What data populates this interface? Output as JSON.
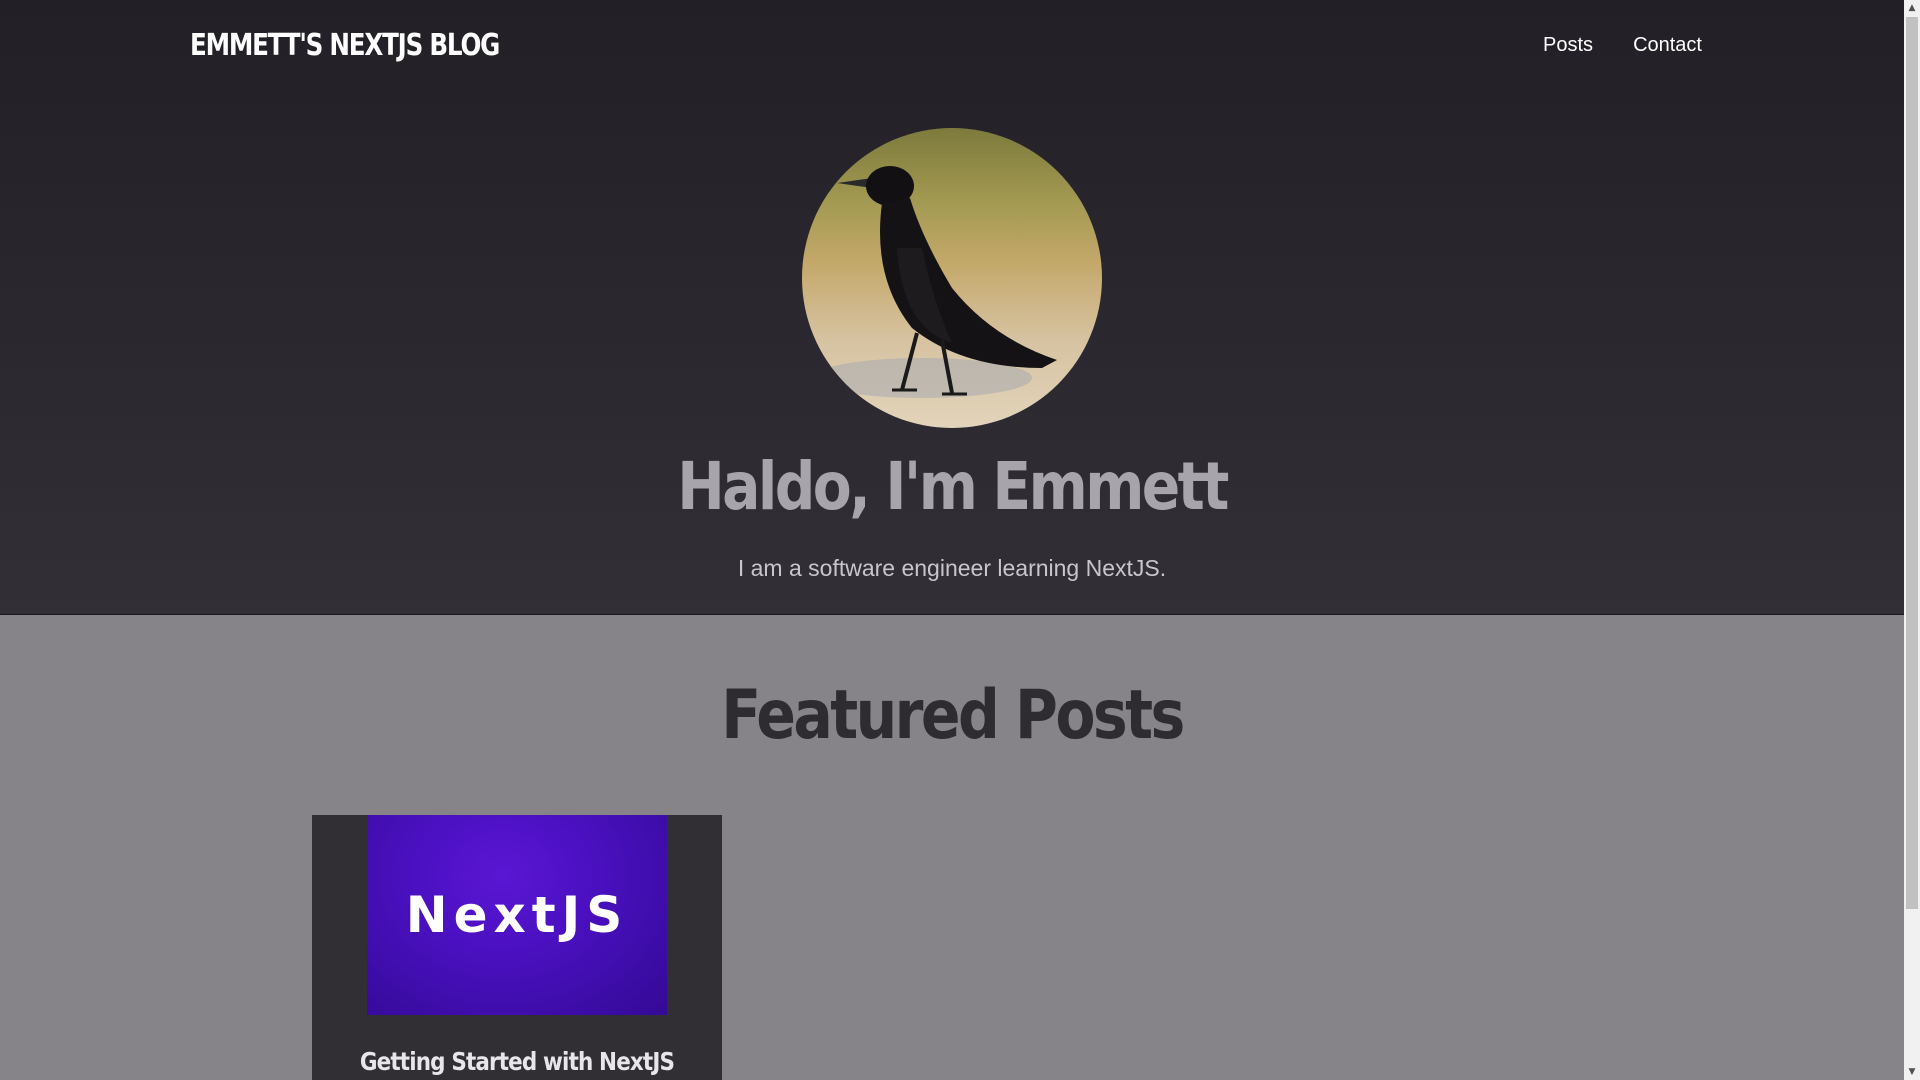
{
  "header": {
    "brand": "EMMETT'S NEXTJS BLOG",
    "nav": {
      "posts": "Posts",
      "contact": "Contact"
    }
  },
  "hero": {
    "title": "Haldo, I'm Emmett",
    "subtitle": "I am a software engineer learning NextJS."
  },
  "featured": {
    "heading": "Featured Posts",
    "posts": [
      {
        "thumb_text": "NextJS",
        "title": "Getting Started with NextJS"
      }
    ]
  },
  "colors": {
    "hero_bg": "#29272d",
    "page_bg": "#868389",
    "card_bg": "#312e34",
    "thumb_purple": "#4a10c0"
  },
  "icons": {
    "scroll_up": "chevron-up-icon",
    "scroll_down": "chevron-down-icon"
  }
}
